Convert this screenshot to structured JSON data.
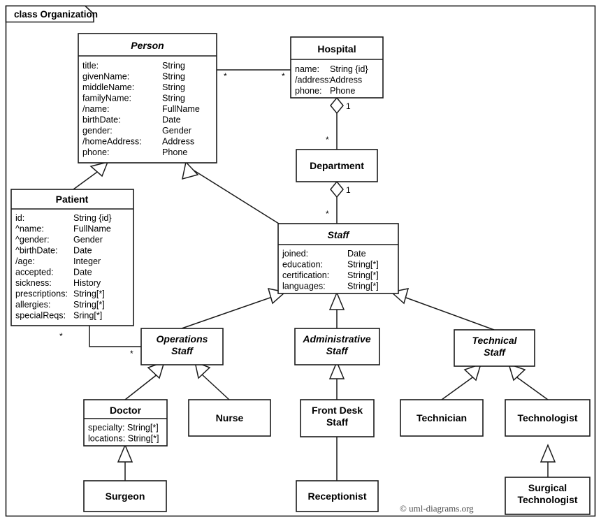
{
  "frame": {
    "label": "class Organization"
  },
  "watermark": {
    "text": "© uml-diagrams.org"
  },
  "classes": {
    "person": {
      "name": "Person",
      "abstract": true,
      "attributes": [
        {
          "name": "title:",
          "type": "String"
        },
        {
          "name": "givenName:",
          "type": "String"
        },
        {
          "name": "middleName:",
          "type": "String"
        },
        {
          "name": "familyName:",
          "type": "String"
        },
        {
          "name": "/name:",
          "type": "FullName"
        },
        {
          "name": "birthDate:",
          "type": "Date"
        },
        {
          "name": "gender:",
          "type": "Gender"
        },
        {
          "name": "/homeAddress:",
          "type": "Address"
        },
        {
          "name": "phone:",
          "type": "Phone"
        }
      ]
    },
    "hospital": {
      "name": "Hospital",
      "abstract": false,
      "attributes": [
        {
          "name": "name:",
          "type": "String {id}"
        },
        {
          "name": "/address:",
          "type": "Address"
        },
        {
          "name": "phone:",
          "type": "Phone"
        }
      ]
    },
    "department": {
      "name": "Department",
      "abstract": false,
      "attributes": []
    },
    "patient": {
      "name": "Patient",
      "abstract": false,
      "attributes": [
        {
          "name": "id:",
          "type": "String {id}"
        },
        {
          "name": "^name:",
          "type": "FullName"
        },
        {
          "name": "^gender:",
          "type": "Gender"
        },
        {
          "name": "^birthDate:",
          "type": "Date"
        },
        {
          "name": "/age:",
          "type": "Integer"
        },
        {
          "name": "accepted:",
          "type": "Date"
        },
        {
          "name": "sickness:",
          "type": "History"
        },
        {
          "name": "prescriptions:",
          "type": "String[*]"
        },
        {
          "name": "allergies:",
          "type": "String[*]"
        },
        {
          "name": "specialReqs:",
          "type": "Sring[*]"
        }
      ]
    },
    "staff": {
      "name": "Staff",
      "abstract": true,
      "attributes": [
        {
          "name": "joined:",
          "type": "Date"
        },
        {
          "name": "education:",
          "type": "String[*]"
        },
        {
          "name": "certification:",
          "type": "String[*]"
        },
        {
          "name": "languages:",
          "type": "String[*]"
        }
      ]
    },
    "operations_staff": {
      "name_line1": "Operations",
      "name_line2": "Staff",
      "abstract": true
    },
    "administrative_staff": {
      "name_line1": "Administrative",
      "name_line2": "Staff",
      "abstract": true
    },
    "technical_staff": {
      "name_line1": "Technical",
      "name_line2": "Staff",
      "abstract": true
    },
    "doctor": {
      "name": "Doctor",
      "abstract": false,
      "attributes": [
        {
          "name": "specialty: String[*]"
        },
        {
          "name": "locations: String[*]"
        }
      ]
    },
    "nurse": {
      "name": "Nurse",
      "abstract": false
    },
    "front_desk_staff": {
      "name_line1": "Front Desk",
      "name_line2": "Staff",
      "abstract": false
    },
    "technician": {
      "name": "Technician",
      "abstract": false
    },
    "technologist": {
      "name": "Technologist",
      "abstract": false
    },
    "surgeon": {
      "name": "Surgeon",
      "abstract": false
    },
    "receptionist": {
      "name": "Receptionist",
      "abstract": false
    },
    "surgical_technologist": {
      "name_line1": "Surgical",
      "name_line2": "Technologist",
      "abstract": false
    }
  },
  "multiplicities": {
    "person_hospital_person_end": "*",
    "person_hospital_hospital_end": "*",
    "hospital_department_hospital_end": "1",
    "hospital_department_department_end": "*",
    "department_staff_department_end": "1",
    "department_staff_staff_end": "*",
    "patient_operations_patient_end": "*",
    "patient_operations_operations_end": "*"
  },
  "colors": {
    "stroke": "#1a1a1a",
    "fill": "#ffffff",
    "watermark": "#4a4a4a"
  }
}
